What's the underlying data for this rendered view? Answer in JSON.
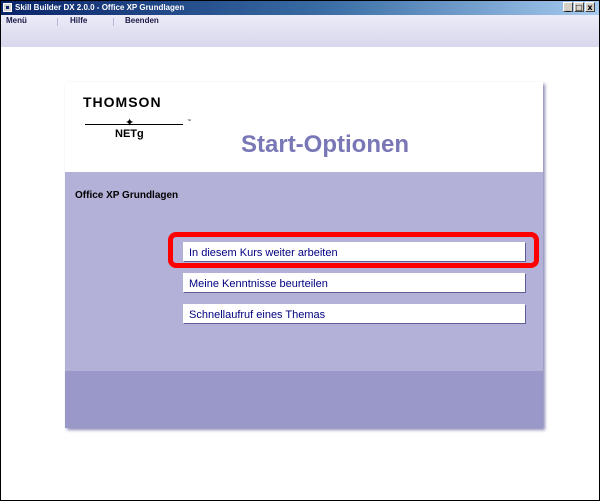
{
  "window": {
    "title": "Skill Builder DX 2.0.0 - Office XP Grundlagen",
    "controls": {
      "minimize": "_",
      "maximize": "□",
      "close": "x"
    }
  },
  "menubar": {
    "items": [
      "Menü",
      "Hilfe",
      "Beenden"
    ]
  },
  "panel": {
    "logo_brand": "THOMSON",
    "logo_sub": "NETg",
    "logo_tm": "™",
    "heading": "Start-Optionen",
    "course_name": "Office XP Grundlagen",
    "options": [
      "In diesem Kurs weiter arbeiten",
      "Meine Kenntnisse beurteilen",
      "Schnellaufruf eines Themas"
    ]
  },
  "colors": {
    "accent_highlight": "#ff0000",
    "panel_bg": "#b3b1d8",
    "heading": "#7977b6"
  }
}
